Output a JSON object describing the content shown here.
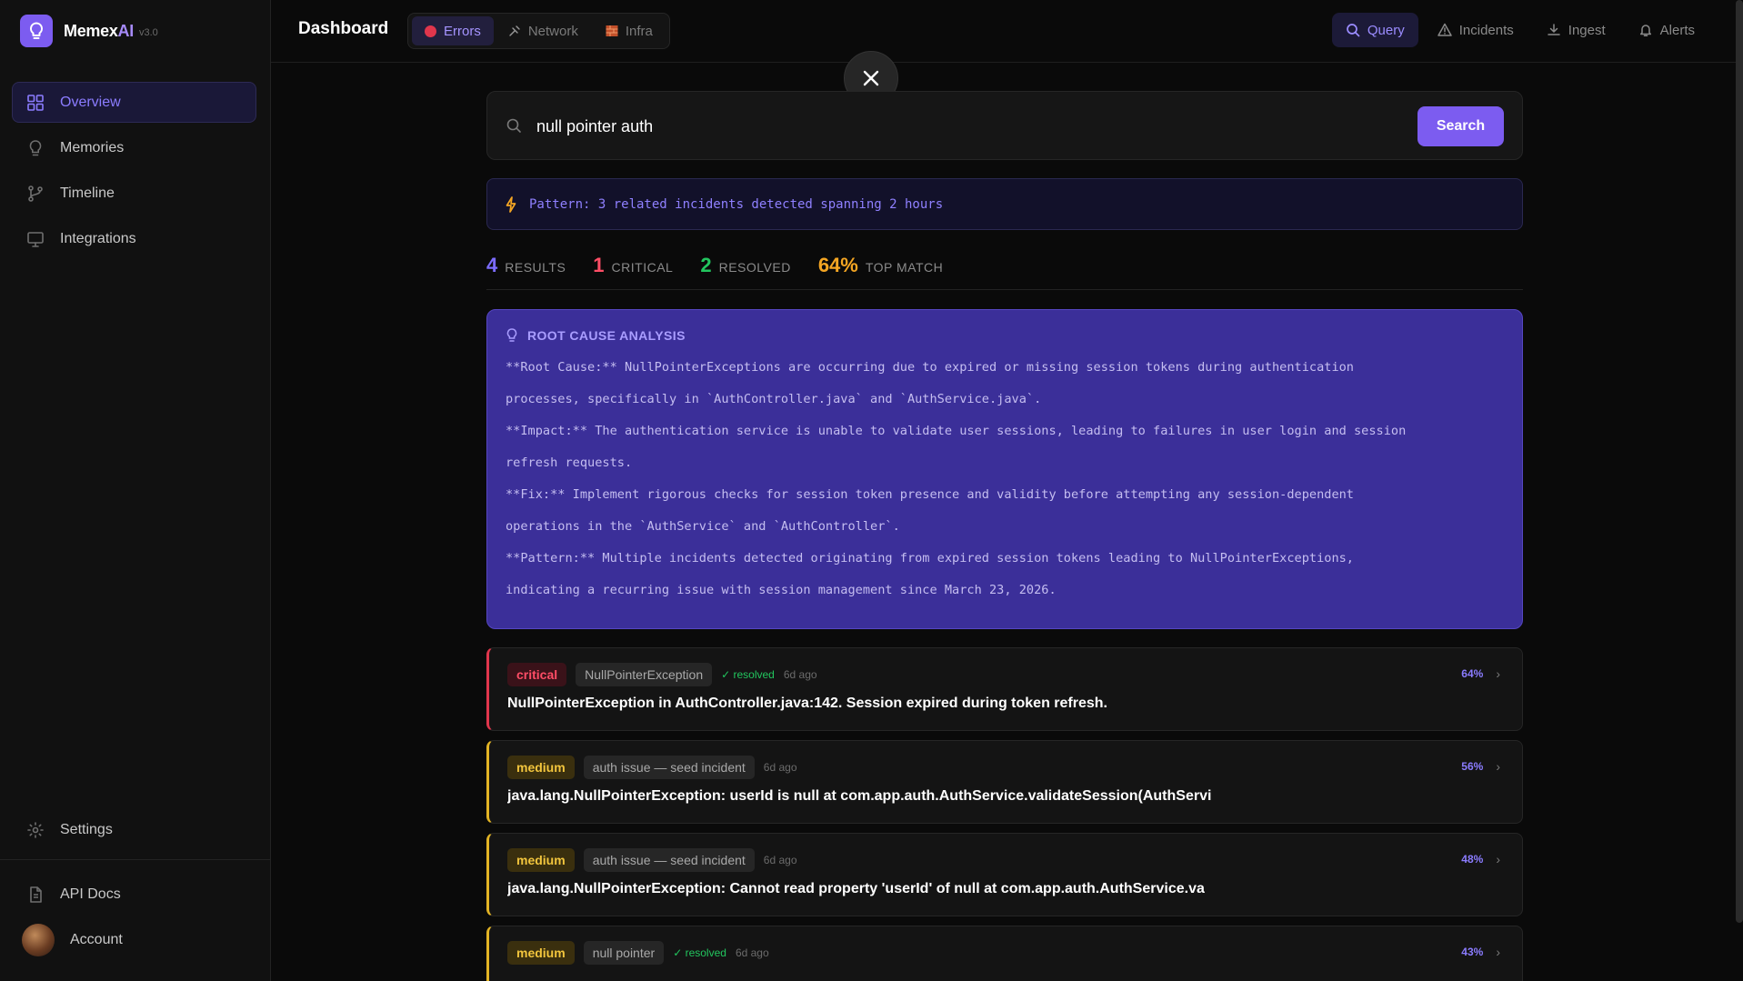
{
  "brand": {
    "name_main": "Memex",
    "name_accent": "AI",
    "version": "v3.0"
  },
  "sidebar": {
    "items": [
      {
        "label": "Overview",
        "icon": "grid-icon",
        "active": true
      },
      {
        "label": "Memories",
        "icon": "lightbulb-icon",
        "active": false
      },
      {
        "label": "Timeline",
        "icon": "git-branch-icon",
        "active": false
      },
      {
        "label": "Integrations",
        "icon": "monitor-icon",
        "active": false
      }
    ],
    "settings_label": "Settings",
    "api_docs_label": "API Docs",
    "account_label": "Account"
  },
  "header": {
    "title": "Dashboard",
    "segments": [
      {
        "label": "Errors",
        "icon": "red-dot-icon",
        "active": true
      },
      {
        "label": "Network",
        "icon": "satellite-icon",
        "active": false
      },
      {
        "label": "Infra",
        "icon": "brick-icon",
        "active": false
      }
    ],
    "actions": [
      {
        "label": "Query",
        "icon": "search-icon",
        "active": true
      },
      {
        "label": "Incidents",
        "icon": "warning-icon",
        "active": false
      },
      {
        "label": "Ingest",
        "icon": "download-icon",
        "active": false
      },
      {
        "label": "Alerts",
        "icon": "bell-icon",
        "active": false
      }
    ]
  },
  "search": {
    "value": "null pointer auth",
    "button_label": "Search"
  },
  "pattern": {
    "text": "Pattern: 3 related incidents detected spanning 2 hours"
  },
  "stats": [
    {
      "value": "4",
      "label": "RESULTS",
      "color": "#7c6cff"
    },
    {
      "value": "1",
      "label": "CRITICAL",
      "color": "#ff4d66"
    },
    {
      "value": "2",
      "label": "RESOLVED",
      "color": "#22c55e"
    },
    {
      "value": "64%",
      "label": "TOP MATCH",
      "color": "#f5a623"
    }
  ],
  "rca": {
    "title": "ROOT CAUSE ANALYSIS",
    "lines": [
      "**Root Cause:** NullPointerExceptions are occurring due to expired or missing session tokens during authentication",
      "processes, specifically in `AuthController.java` and `AuthService.java`.",
      "**Impact:** The authentication service is unable to validate user sessions, leading to failures in user login and session",
      "refresh requests.",
      "**Fix:** Implement rigorous checks for session token presence and validity before attempting any session-dependent",
      "operations in the `AuthService` and `AuthController`.",
      "**Pattern:** Multiple incidents detected originating from expired session tokens leading to NullPointerExceptions,",
      "indicating a recurring issue with session management since March 23, 2026."
    ]
  },
  "results": [
    {
      "severity": "critical",
      "tag": "NullPointerException",
      "resolved": "✓ resolved",
      "ago": "6d ago",
      "score": "64%",
      "message": "NullPointerException in AuthController.java:142. Session expired during token refresh."
    },
    {
      "severity": "medium",
      "tag": "auth issue — seed incident",
      "resolved": "",
      "ago": "6d ago",
      "score": "56%",
      "message": "java.lang.NullPointerException: userId is null at com.app.auth.AuthService.validateSession(AuthServi"
    },
    {
      "severity": "medium",
      "tag": "auth issue — seed incident",
      "resolved": "",
      "ago": "6d ago",
      "score": "48%",
      "message": "java.lang.NullPointerException: Cannot read property 'userId' of null at com.app.auth.AuthService.va"
    },
    {
      "severity": "medium",
      "tag": "null pointer",
      "resolved": "✓ resolved",
      "ago": "6d ago",
      "score": "43%",
      "message": ""
    }
  ]
}
